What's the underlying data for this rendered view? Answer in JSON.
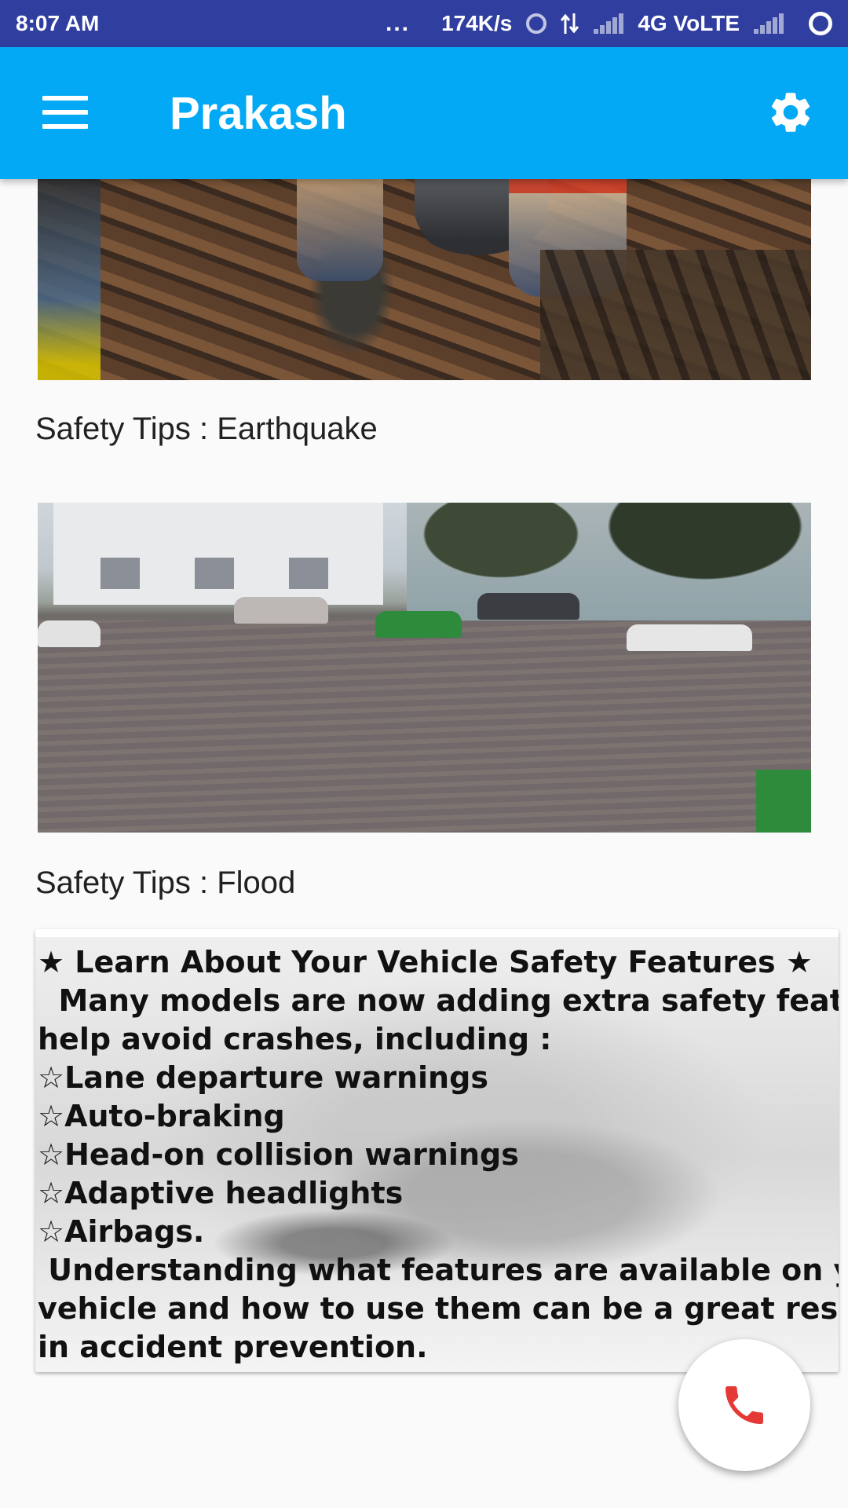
{
  "status_bar": {
    "time": "8:07 AM",
    "dots": "...",
    "speed": "174K/s",
    "network": "4G VoLTE",
    "icons": [
      "hotspot-icon",
      "data-arrows-icon",
      "signal-icon",
      "signal-icon",
      "sync-icon"
    ]
  },
  "app_bar": {
    "title": "Prakash",
    "menu_icon": "hamburger-menu-icon",
    "settings_icon": "gear-icon",
    "color": "#03a9f4"
  },
  "cards": [
    {
      "label": "Safety Tips : Earthquake",
      "image": "earthquake-rubble-photo"
    },
    {
      "label": "Safety Tips : Flood",
      "image": "flooded-street-photo"
    }
  ],
  "info": {
    "lines": [
      "★ Learn About Your Vehicle Safety Features ★",
      "  Many models are now adding extra safety features to",
      "help avoid crashes, including :",
      "☆Lane departure warnings",
      "☆Auto-braking",
      "☆Head-on collision warnings",
      "☆Adaptive headlights",
      "☆Airbags.",
      " Understanding what features are available on your",
      "vehicle and how to use them can be a great resource",
      "in accident prevention."
    ],
    "background_image": "car-photo"
  },
  "fab": {
    "icon": "phone-icon",
    "icon_color": "#e53935"
  }
}
